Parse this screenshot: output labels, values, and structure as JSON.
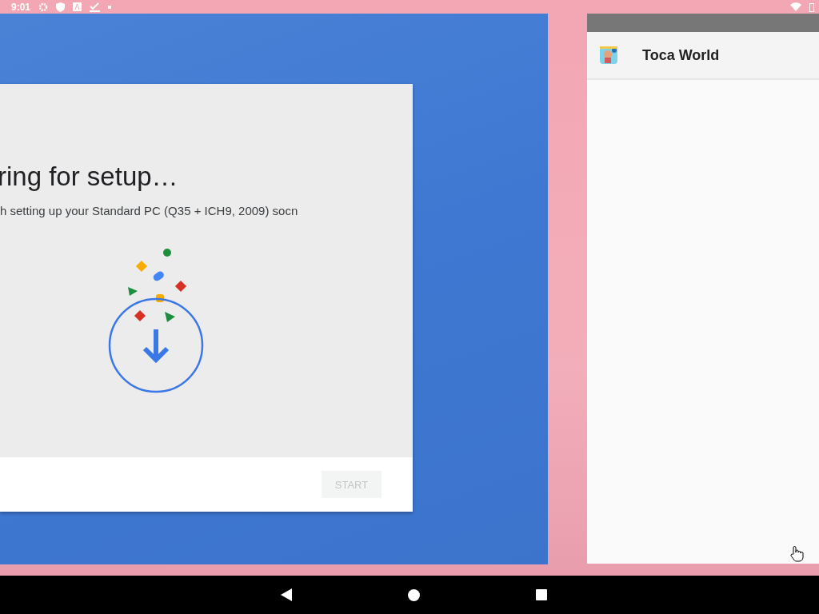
{
  "status_bar": {
    "time": "9:01"
  },
  "setup_window": {
    "title": "ring for setup…",
    "subtitle": "h setting up your Standard PC (Q35 + ICH9, 2009) socn",
    "start_button": {
      "label": "START",
      "disabled": true
    }
  },
  "app_window": {
    "title": "Toca World"
  }
}
